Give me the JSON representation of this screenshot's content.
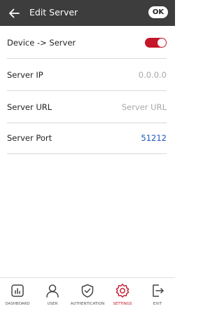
{
  "header": {
    "title": "Edit Server",
    "ok_label": "OK"
  },
  "rows": [
    {
      "label": "Device -> Server",
      "type": "toggle",
      "toggle_on": true
    },
    {
      "label": "Server IP",
      "value": "0.0.0.0"
    },
    {
      "label": "Server URL",
      "value": "Server URL"
    },
    {
      "label": "Server Port",
      "value": "51212"
    }
  ],
  "nav": {
    "items": [
      {
        "label": "DASHBOARD",
        "icon": "dashboard-icon",
        "active": false
      },
      {
        "label": "USER",
        "icon": "user-icon",
        "active": false
      },
      {
        "label": "AUTHENTICATION",
        "icon": "shield-check-icon",
        "active": false
      },
      {
        "label": "SETTINGS",
        "icon": "gear-icon",
        "active": true
      },
      {
        "label": "EXIT",
        "icon": "exit-icon",
        "active": false
      }
    ]
  },
  "colors": {
    "header_bg": "#3d3d3d",
    "accent": "#c5162b",
    "link": "#1f56c4",
    "muted": "#a8a8a8"
  }
}
